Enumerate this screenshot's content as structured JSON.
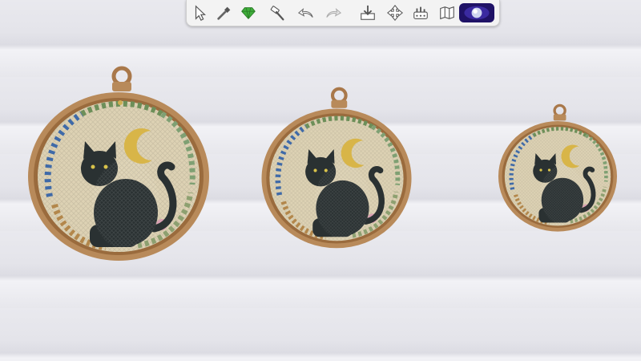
{
  "toolbar": {
    "tools": [
      {
        "icon": "select-arrow-icon"
      },
      {
        "icon": "eyedropper-icon"
      },
      {
        "icon": "design-tool-icon"
      },
      {
        "icon": "sledgehammer-icon"
      },
      {
        "icon": "undo-icon"
      },
      {
        "icon": "redo-icon"
      },
      {
        "icon": "save-to-library-icon"
      },
      {
        "icon": "move-icon"
      },
      {
        "icon": "terrain-tools-icon"
      },
      {
        "icon": "blueprint-icon"
      },
      {
        "icon": "room-walls-icon"
      },
      {
        "icon": "camera-view-icon",
        "active": true
      }
    ]
  },
  "colors": {
    "hoop_wood": "#b88a5a",
    "fabric": "#ddd2b4",
    "cat": "#2a3132",
    "moon": "#d8b548",
    "active_tool": "#2a1a7a"
  },
  "hoops": [
    {
      "name": "cross-stitch-cat-hoop-large"
    },
    {
      "name": "cross-stitch-cat-hoop-medium"
    },
    {
      "name": "cross-stitch-cat-hoop-small"
    }
  ]
}
